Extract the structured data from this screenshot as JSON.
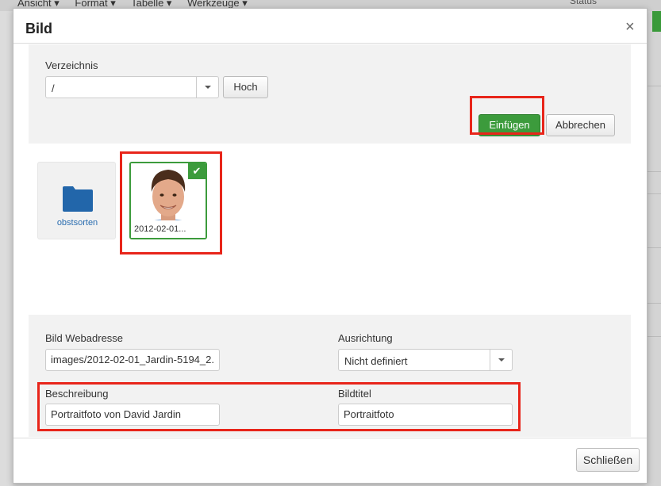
{
  "background": {
    "menu_items": [
      "Ansicht ▾",
      "Format ▾",
      "Tabelle ▾",
      "Werkzeuge ▾"
    ],
    "right_status": "Status"
  },
  "modal": {
    "title": "Bild",
    "close_label": "×"
  },
  "directory": {
    "label": "Verzeichnis",
    "value": "/",
    "up_button": "Hoch"
  },
  "actions": {
    "insert_button": "Einfügen",
    "cancel_button": "Abbrechen"
  },
  "browser": {
    "folder": {
      "name": "obstsorten",
      "icon": "folder-icon",
      "color": "#2a6db0"
    },
    "image": {
      "caption": "2012-02-01...",
      "selected": true,
      "icon": "checkmark-icon"
    }
  },
  "form": {
    "url_label": "Bild Webadresse",
    "url_value": "images/2012-02-01_Jardin-5194_2.",
    "align_label": "Ausrichtung",
    "align_value": "Nicht definiert",
    "description_label": "Beschreibung",
    "description_value": "Portraitfoto von David Jardin",
    "title_label": "Bildtitel",
    "title_value": "Portraitfoto"
  },
  "footer": {
    "close_button": "Schließen"
  },
  "colors": {
    "accent_green": "#3c9b3c",
    "highlight_red": "#e8251a"
  }
}
